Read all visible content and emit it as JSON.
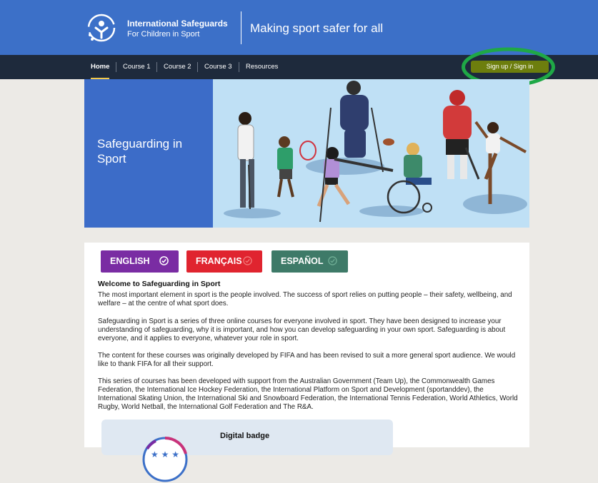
{
  "header": {
    "org_name": "International Safeguards",
    "org_subtitle": "For Children in Sport",
    "tagline": "Making sport safer for all"
  },
  "nav": {
    "items": [
      {
        "label": "Home",
        "active": true
      },
      {
        "label": "Course 1",
        "active": false
      },
      {
        "label": "Course 2",
        "active": false
      },
      {
        "label": "Course 3",
        "active": false
      },
      {
        "label": "Resources",
        "active": false
      }
    ],
    "signup_label": "Sign up / Sign in"
  },
  "hero": {
    "title": "Safeguarding in Sport"
  },
  "languages": [
    {
      "label": "ENGLISH",
      "color": "#7a2ca3"
    },
    {
      "label": "FRANÇAIS",
      "color": "#e0242f"
    },
    {
      "label": "ESPAÑOL",
      "color": "#3e7a68"
    }
  ],
  "main": {
    "heading": "Welcome to Safeguarding in Sport",
    "paragraphs": [
      "The most important element in sport is the people involved. The success of sport relies on putting people – their safety, wellbeing, and welfare – at the centre of what sport does.",
      "Safeguarding in Sport is a series of three online courses for everyone involved in sport. They have been designed to increase your understanding of safeguarding, why it is important, and how you can develop safeguarding in your own sport. Safeguarding is about everyone, and it applies to everyone, whatever your role in sport.",
      "The content for these courses was originally developed by FIFA and has been revised to suit a more general sport audience. We would like to thank FIFA for all their support.",
      "This series of courses has been developed with support from the Australian Government (Team Up), the Commonwealth Games Federation, the International Ice Hockey Federation, the International Platform on Sport and Development (sportanddev), the International Skating Union, the International Ski and Snowboard Federation, the International Tennis Federation, World Athletics, World Rugby, World Netball, the International Golf Federation and The R&A."
    ],
    "badge_title": "Digital badge"
  },
  "colors": {
    "header_blue": "#3c70c8",
    "nav_dark": "#1e2a3c",
    "signup_green": "#6d7e0d",
    "highlight_ring": "#1fa846",
    "active_underline": "#f2c94c"
  }
}
